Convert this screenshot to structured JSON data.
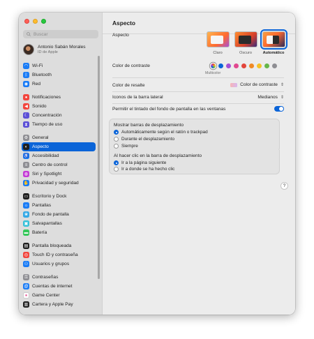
{
  "sidebar": {
    "search_placeholder": "Buscar",
    "account": {
      "name": "Antonio Sabán Morales",
      "subtitle": "ID de Apple"
    },
    "groups": [
      [
        {
          "label": "Wi-Fi",
          "icon": "wifi-icon",
          "color": "#1a7cf6",
          "glyph": "◠"
        },
        {
          "label": "Bluetooth",
          "icon": "bluetooth-icon",
          "color": "#1a7cf6",
          "glyph": "ᛒ"
        },
        {
          "label": "Red",
          "icon": "network-icon",
          "color": "#1a7cf6",
          "glyph": "◉"
        }
      ],
      [
        {
          "label": "Notificaciones",
          "icon": "bell-icon",
          "color": "#f2453d",
          "glyph": "●"
        },
        {
          "label": "Sonido",
          "icon": "speaker-icon",
          "color": "#f2453d",
          "glyph": "◀"
        },
        {
          "label": "Concentración",
          "icon": "moon-icon",
          "color": "#5b4fd6",
          "glyph": "☾"
        },
        {
          "label": "Tiempo de uso",
          "icon": "hourglass-icon",
          "color": "#5b4fd6",
          "glyph": "⧗"
        }
      ],
      [
        {
          "label": "General",
          "icon": "gear-icon",
          "color": "#8e8e93",
          "glyph": "⚙"
        },
        {
          "label": "Aspecto",
          "icon": "appearance-icon",
          "color": "#1f1f1f",
          "glyph": "◐",
          "active": true
        },
        {
          "label": "Accesibilidad",
          "icon": "accessibility-icon",
          "color": "#1a7cf6",
          "glyph": "♿"
        },
        {
          "label": "Centro de control",
          "icon": "control-center-icon",
          "color": "#8e8e93",
          "glyph": "≡"
        },
        {
          "label": "Siri y Spotlight",
          "icon": "siri-icon",
          "color": "#c43ad6",
          "glyph": "◍"
        },
        {
          "label": "Privacidad y seguridad",
          "icon": "hand-icon",
          "color": "#1a7cf6",
          "glyph": "✋"
        }
      ],
      [
        {
          "label": "Escritorio y Dock",
          "icon": "dock-icon",
          "color": "#1f1f1f",
          "glyph": "▭"
        },
        {
          "label": "Pantallas",
          "icon": "display-icon",
          "color": "#1a7cf6",
          "glyph": "☼"
        },
        {
          "label": "Fondo de pantalla",
          "icon": "wallpaper-icon",
          "color": "#35a9e6",
          "glyph": "❀"
        },
        {
          "label": "Salvapantallas",
          "icon": "screensaver-icon",
          "color": "#35c0d8",
          "glyph": "▣"
        },
        {
          "label": "Batería",
          "icon": "battery-icon",
          "color": "#34c759",
          "glyph": "▬"
        }
      ],
      [
        {
          "label": "Pantalla bloqueada",
          "icon": "lock-screen-icon",
          "color": "#1f1f1f",
          "glyph": "▤"
        },
        {
          "label": "Touch ID y contraseña",
          "icon": "fingerprint-icon",
          "color": "#f2453d",
          "glyph": "◎"
        },
        {
          "label": "Usuarios y grupos",
          "icon": "users-icon",
          "color": "#1a7cf6",
          "glyph": "⚇"
        }
      ],
      [
        {
          "label": "Contraseñas",
          "icon": "key-icon",
          "color": "#8e8e93",
          "glyph": "⚿"
        },
        {
          "label": "Cuentas de internet",
          "icon": "at-icon",
          "color": "#1a7cf6",
          "glyph": "@"
        },
        {
          "label": "Game Center",
          "icon": "game-center-icon",
          "color": "#ffffff",
          "glyph": "●"
        },
        {
          "label": "Cartera y Apple Pay",
          "icon": "wallet-icon",
          "color": "#1f1f1f",
          "glyph": "▥"
        }
      ]
    ]
  },
  "main": {
    "title": "Aspecto",
    "appearance": {
      "label": "Aspecto",
      "options": [
        {
          "label": "Claro",
          "selected": false
        },
        {
          "label": "Oscuro",
          "selected": false
        },
        {
          "label": "Automático",
          "selected": true
        }
      ]
    },
    "accent": {
      "label": "Color de contraste",
      "caption": "Multicolor",
      "colors": [
        "#8a7cf2",
        "#0a64d8",
        "#a54fd6",
        "#e1488f",
        "#e2453b",
        "#f08a24",
        "#f5c226",
        "#66b64a",
        "#8e8e93"
      ]
    },
    "highlight": {
      "label": "Color de resalte",
      "value": "Color de contraste"
    },
    "sidebar_icons": {
      "label": "Iconos de la barra lateral",
      "value": "Medianos"
    },
    "tinting": {
      "label": "Permitir el tintado del fondo de pantalla en las ventanas",
      "enabled": true
    },
    "scrollbars": {
      "title": "Mostrar barras de desplazamiento",
      "options": [
        {
          "label": "Automáticamente según el ratón o trackpad",
          "selected": true
        },
        {
          "label": "Durante el desplazamiento",
          "selected": false
        },
        {
          "label": "Siempre",
          "selected": false
        }
      ]
    },
    "click_scrollbar": {
      "title": "Al hacer clic en la barra de desplazamiento",
      "options": [
        {
          "label": "Ir a la página siguiente",
          "selected": true
        },
        {
          "label": "Ir a donde se ha hecho clic",
          "selected": false
        }
      ]
    },
    "help_label": "?"
  }
}
